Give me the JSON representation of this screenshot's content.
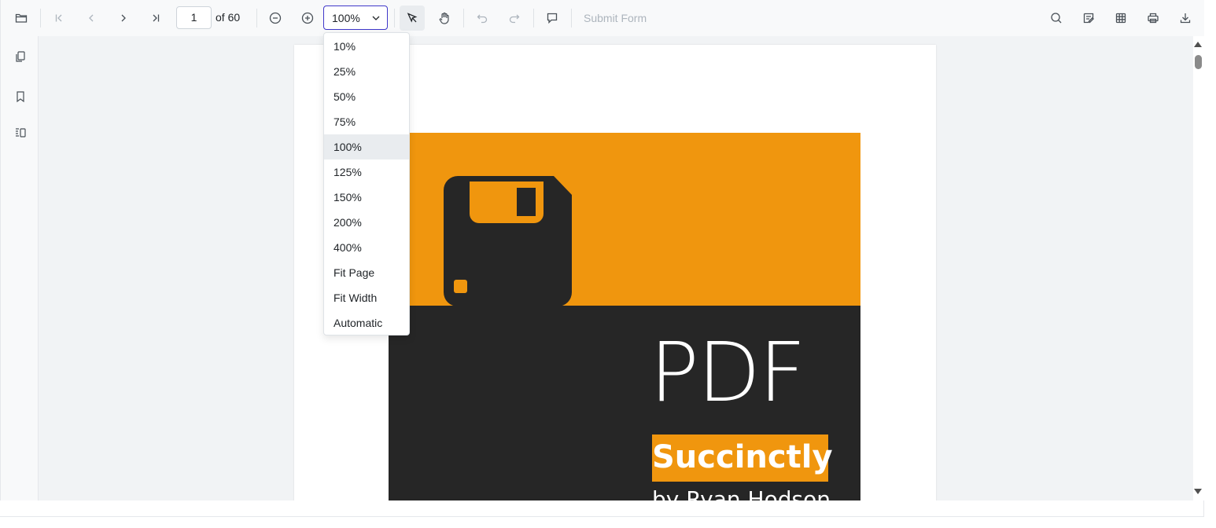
{
  "toolbar": {
    "current_page": "1",
    "page_count_text": "of 60",
    "zoom_value": "100%",
    "submit_form_label": "Submit Form",
    "icons": [
      "folder-open-icon",
      "first-page-icon",
      "previous-page-icon",
      "next-page-icon",
      "last-page-icon",
      "zoom-out-icon",
      "zoom-in-icon",
      "chevron-down-icon",
      "text-select-icon",
      "pan-hand-icon",
      "undo-icon",
      "redo-icon",
      "comment-icon",
      "search-icon",
      "annotation-icon",
      "form-designer-icon",
      "print-icon",
      "download-icon"
    ]
  },
  "sidebar": {
    "icons": [
      "page-thumbnails-icon",
      "bookmark-icon",
      "organize-pages-icon"
    ]
  },
  "zoom_dropdown": {
    "options": [
      "10%",
      "25%",
      "50%",
      "75%",
      "100%",
      "125%",
      "150%",
      "200%",
      "400%",
      "Fit Page",
      "Fit Width",
      "Automatic"
    ],
    "selected": "100%"
  },
  "document": {
    "cover_title": "PDF",
    "series_name": "Succinctly",
    "author_line": "by Ryan Hodson"
  },
  "colors": {
    "accent": "#3f37c9",
    "cover_orange": "#f0960e",
    "cover_dark": "#262626"
  }
}
